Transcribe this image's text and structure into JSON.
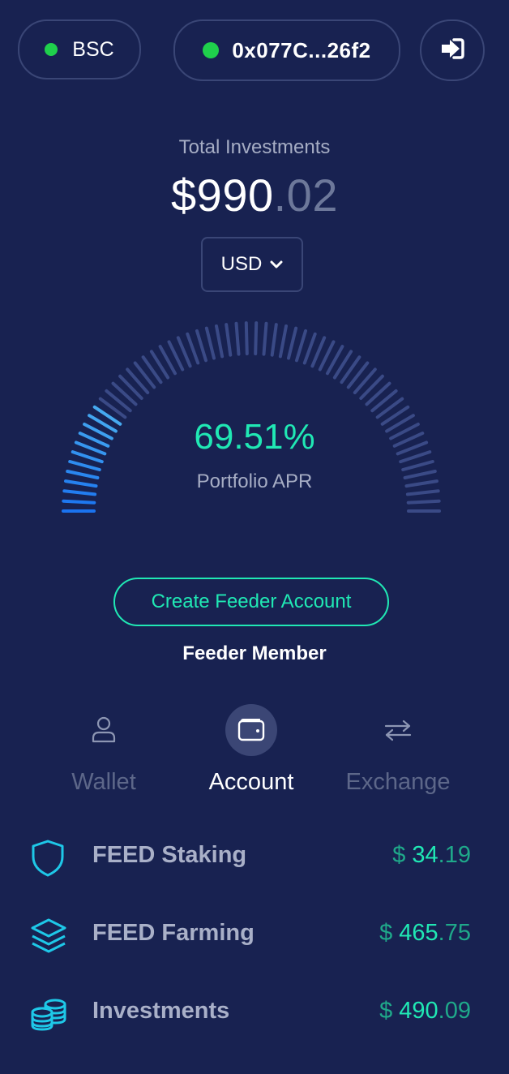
{
  "header": {
    "network": "BSC",
    "address": "0x077C...26f2",
    "status_color": "#1fd04c",
    "logout_icon": "sign-out-icon"
  },
  "summary": {
    "label": "Total Investments",
    "amount_main": "$990",
    "amount_cents": ".02",
    "currency": "USD"
  },
  "gauge": {
    "apr_value": "69.51%",
    "apr_label": "Portfolio APR",
    "fill_fraction": 0.1951,
    "active_color": "#1a73f0",
    "inactive_color": "#3a4a86",
    "accent_color": "#20e8b4"
  },
  "actions": {
    "create_button": "Create Feeder Account",
    "member_label": "Feeder Member"
  },
  "tabs": [
    {
      "label": "Wallet",
      "icon": "user-icon",
      "active": false
    },
    {
      "label": "Account",
      "icon": "wallet-icon",
      "active": true
    },
    {
      "label": "Exchange",
      "icon": "exchange-arrows-icon",
      "active": false
    }
  ],
  "rows": [
    {
      "label": "FEED Staking",
      "icon": "shield-icon",
      "currency": "$",
      "int": "34",
      "dec": ".19"
    },
    {
      "label": "FEED Farming",
      "icon": "layers-icon",
      "currency": "$",
      "int": "465",
      "dec": ".75"
    },
    {
      "label": "Investments",
      "icon": "coins-icon",
      "currency": "$",
      "int": "490",
      "dec": ".09"
    }
  ]
}
